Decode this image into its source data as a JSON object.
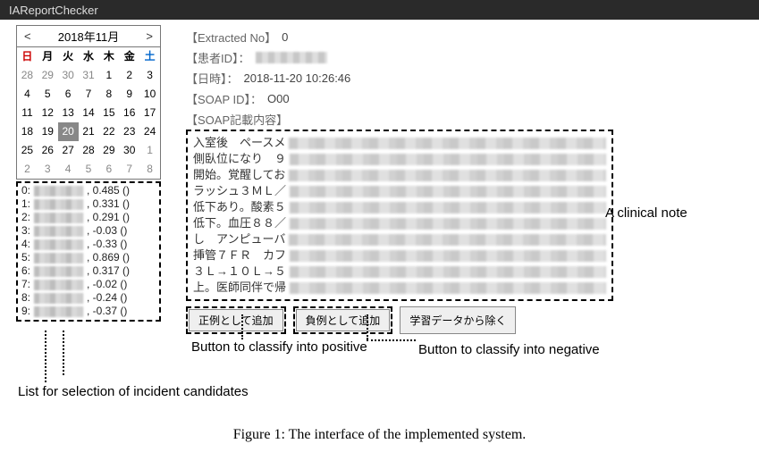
{
  "titlebar": {
    "app_name": "IAReportChecker"
  },
  "calendar": {
    "month_label": "2018年11月",
    "dow": [
      "日",
      "月",
      "火",
      "水",
      "木",
      "金",
      "土"
    ],
    "cells": [
      {
        "d": 28,
        "other": true
      },
      {
        "d": 29,
        "other": true
      },
      {
        "d": 30,
        "other": true
      },
      {
        "d": 31,
        "other": true
      },
      {
        "d": 1
      },
      {
        "d": 2
      },
      {
        "d": 3
      },
      {
        "d": 4
      },
      {
        "d": 5
      },
      {
        "d": 6
      },
      {
        "d": 7
      },
      {
        "d": 8
      },
      {
        "d": 9
      },
      {
        "d": 10
      },
      {
        "d": 11
      },
      {
        "d": 12
      },
      {
        "d": 13
      },
      {
        "d": 14
      },
      {
        "d": 15
      },
      {
        "d": 16
      },
      {
        "d": 17
      },
      {
        "d": 18
      },
      {
        "d": 19
      },
      {
        "d": 20,
        "sel": true
      },
      {
        "d": 21
      },
      {
        "d": 22
      },
      {
        "d": 23
      },
      {
        "d": 24
      },
      {
        "d": 25
      },
      {
        "d": 26
      },
      {
        "d": 27
      },
      {
        "d": 28
      },
      {
        "d": 29
      },
      {
        "d": 30
      },
      {
        "d": 1,
        "other": true
      },
      {
        "d": 2,
        "other": true
      },
      {
        "d": 3,
        "other": true
      },
      {
        "d": 4,
        "other": true
      },
      {
        "d": 5,
        "other": true
      },
      {
        "d": 6,
        "other": true
      },
      {
        "d": 7,
        "other": true
      },
      {
        "d": 8,
        "other": true
      }
    ]
  },
  "candidates": [
    {
      "idx": "0:",
      "score": ", 0.485 ()"
    },
    {
      "idx": "1:",
      "score": ", 0.331 ()"
    },
    {
      "idx": "2:",
      "score": ", 0.291 ()"
    },
    {
      "idx": "3:",
      "score": ", -0.03 ()"
    },
    {
      "idx": "4:",
      "score": ", -0.33 ()"
    },
    {
      "idx": "5:",
      "score": ", 0.869 ()"
    },
    {
      "idx": "6:",
      "score": ", 0.317 ()"
    },
    {
      "idx": "7:",
      "score": ", -0.02 ()"
    },
    {
      "idx": "8:",
      "score": ", -0.24 ()"
    },
    {
      "idx": "9:",
      "score": ", -0.37 ()"
    }
  ],
  "meta": {
    "extracted_no_label": "【Extracted No】",
    "extracted_no_value": "0",
    "patient_id_label": "【患者ID】：",
    "datetime_label": "【日時】：",
    "datetime_value": "2018-11-20 10:26:46",
    "soap_id_label": "【SOAP ID】：",
    "soap_id_value": "O00",
    "soap_content_label": "【SOAP記載内容】"
  },
  "note_lines": [
    "入室後　ペースメ",
    "側臥位になり　９",
    "開始。覚醒してお",
    "ラッシュ３ＭＬ／",
    "低下あり。酸素５",
    "低下。血圧８８／",
    "し　アンピューバ",
    "挿管７ＦＲ　カフ",
    "３Ｌ→１０Ｌ→５",
    "上。医師同伴で帰"
  ],
  "buttons": {
    "positive": "正例として追加",
    "negative": "負例として追加",
    "exclude": "学習データから除く"
  },
  "annotations": {
    "clinical_note": "A clinical note",
    "button_positive": "Button to classify into positive",
    "button_negative": "Button to classify into negative",
    "candidate_list": "List for selection of incident candidates"
  },
  "caption": "Figure 1: The interface of the implemented system."
}
